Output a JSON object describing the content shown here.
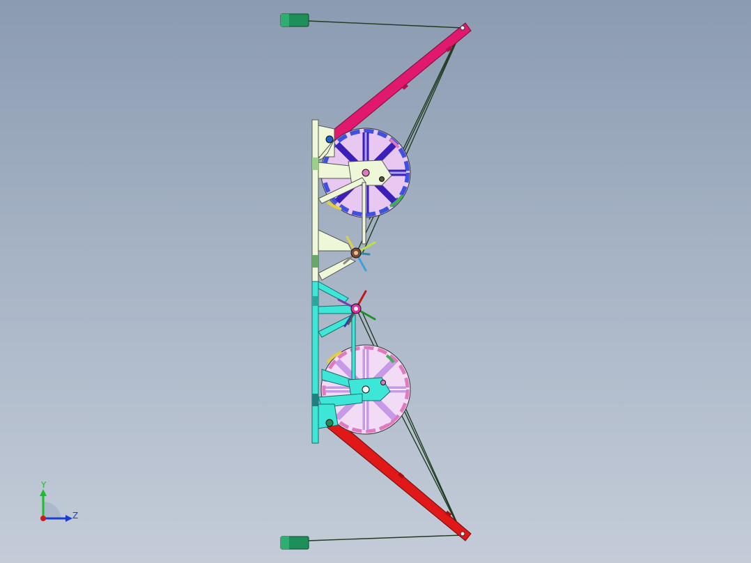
{
  "viewport": {
    "background_top": "#8b9bb1",
    "background_bottom": "#c4ccd8"
  },
  "model": {
    "upper_boom_color": "#e0196e",
    "lower_boom_color": "#e01818",
    "upper_frame_color": "#eef7d8",
    "lower_frame_color": "#3de6d6",
    "upper_wheel_spoke_color": "#3a1fb8",
    "lower_wheel_spoke_color": "#c79ae8",
    "counterweight_color": "#1f8f5a",
    "cable_color": "#1f3a1f"
  },
  "triad": {
    "y_label": "Y",
    "z_label": "Z",
    "y_color": "#1bbf2a",
    "z_color": "#1a3fd0",
    "origin_color": "#d01a1a"
  }
}
